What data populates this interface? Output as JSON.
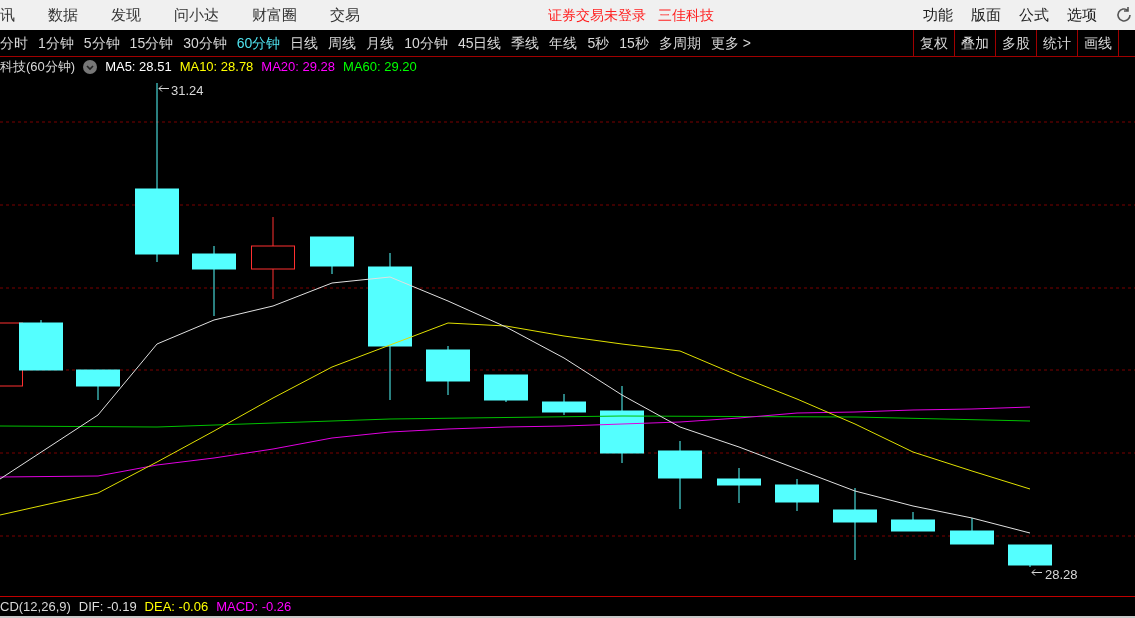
{
  "menu": [
    "讯",
    "数据",
    "发现",
    "问小达",
    "财富圈",
    "交易"
  ],
  "notices": [
    "证券交易未登录",
    "三佳科技"
  ],
  "menu_right": [
    "功能",
    "版面",
    "公式",
    "选项"
  ],
  "periods": [
    {
      "label": "分时",
      "selected": false
    },
    {
      "label": "1分钟",
      "selected": false
    },
    {
      "label": "5分钟",
      "selected": false
    },
    {
      "label": "15分钟",
      "selected": false
    },
    {
      "label": "30分钟",
      "selected": false
    },
    {
      "label": "60分钟",
      "selected": true
    },
    {
      "label": "日线",
      "selected": false
    },
    {
      "label": "周线",
      "selected": false
    },
    {
      "label": "月线",
      "selected": false
    },
    {
      "label": "10分钟",
      "selected": false
    },
    {
      "label": "45日线",
      "selected": false
    },
    {
      "label": "季线",
      "selected": false
    },
    {
      "label": "年线",
      "selected": false
    },
    {
      "label": "5秒",
      "selected": false
    },
    {
      "label": "15秒",
      "selected": false
    },
    {
      "label": "多周期",
      "selected": false
    },
    {
      "label": "更多 >",
      "selected": false
    }
  ],
  "tools": [
    "复权",
    "叠加",
    "多股",
    "统计",
    "画线"
  ],
  "legend": {
    "title": "科技(60分钟)",
    "indicators": [
      {
        "text": "MA5: 28.51",
        "color": "#ffffff"
      },
      {
        "text": "MA10: 28.78",
        "color": "#ffff00"
      },
      {
        "text": "MA20: 29.28",
        "color": "#ff00ff"
      },
      {
        "text": "MA60: 29.20",
        "color": "#00ff00"
      }
    ]
  },
  "chart": {
    "high_label": "31.24",
    "low_label": "28.28"
  },
  "macd": {
    "title": "CD(12,26,9)",
    "indicators": [
      {
        "text": "DIF: -0.19",
        "color": "#dddddd"
      },
      {
        "text": "DEA: -0.06",
        "color": "#ffff00"
      },
      {
        "text": "MACD: -0.26",
        "color": "#ff00ff"
      }
    ]
  }
}
